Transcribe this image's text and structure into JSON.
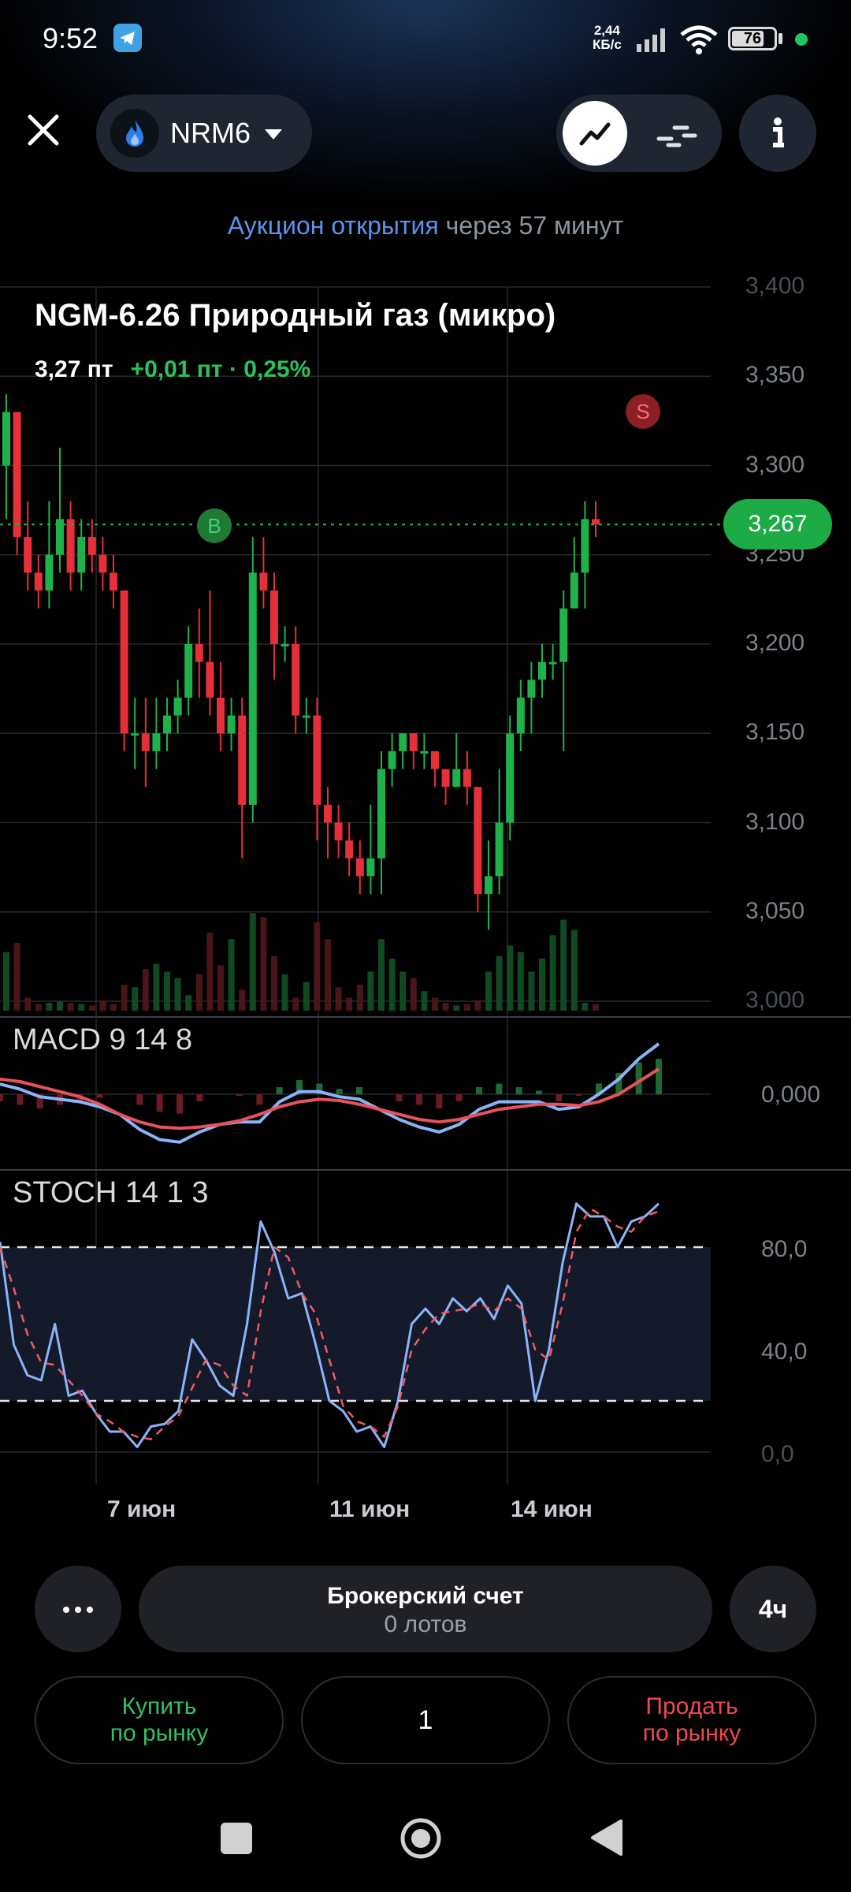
{
  "status_bar": {
    "time": "9:52",
    "net_speed_value": "2,44",
    "net_speed_unit": "КБ/с",
    "battery": "76",
    "battery_level": 0.76,
    "icons": [
      "telegram-icon",
      "signal-icon",
      "wifi-icon",
      "battery-icon"
    ]
  },
  "header": {
    "ticker": "NRM6",
    "chart_mode_selected": "line",
    "notice_highlight": "Аукцион открытия",
    "notice_rest": " через 57 минут"
  },
  "instrument": {
    "title": "NGM-6.26 Природный газ (микро)",
    "price": "3,27 пт",
    "change": "+0,01 пт · 0,25%",
    "current_price_badge": "3,267"
  },
  "chart_data": [
    {
      "type": "candlestick",
      "price_axis": [
        "3,400",
        "3,350",
        "3,300",
        "3,250",
        "3,200",
        "3,150",
        "3,100",
        "3,050",
        "3,000"
      ],
      "ylim": [
        3.0,
        3.4
      ],
      "date_labels": [
        "7 июн",
        "11 июн",
        "14 июн"
      ],
      "current_price": 3.267,
      "markers": [
        {
          "label": "B",
          "index": 18,
          "price": 3.253,
          "color": "#1e7a35"
        },
        {
          "label": "S",
          "index": 60,
          "price": 3.317,
          "color": "#8a1f24"
        }
      ],
      "candles": [
        [
          3.3,
          3.33,
          3.34,
          3.27
        ],
        [
          3.33,
          3.26,
          3.33,
          3.25
        ],
        [
          3.26,
          3.24,
          3.28,
          3.23
        ],
        [
          3.24,
          3.23,
          3.25,
          3.22
        ],
        [
          3.23,
          3.25,
          3.28,
          3.22
        ],
        [
          3.25,
          3.27,
          3.31,
          3.24
        ],
        [
          3.27,
          3.24,
          3.28,
          3.23
        ],
        [
          3.24,
          3.26,
          3.27,
          3.23
        ],
        [
          3.26,
          3.25,
          3.27,
          3.24
        ],
        [
          3.25,
          3.24,
          3.26,
          3.23
        ],
        [
          3.24,
          3.23,
          3.25,
          3.22
        ],
        [
          3.23,
          3.15,
          3.23,
          3.14
        ],
        [
          3.15,
          3.15,
          3.17,
          3.13
        ],
        [
          3.15,
          3.14,
          3.17,
          3.12
        ],
        [
          3.14,
          3.15,
          3.17,
          3.13
        ],
        [
          3.15,
          3.16,
          3.17,
          3.14
        ],
        [
          3.16,
          3.17,
          3.18,
          3.15
        ],
        [
          3.17,
          3.2,
          3.21,
          3.16
        ],
        [
          3.2,
          3.19,
          3.22,
          3.17
        ],
        [
          3.19,
          3.17,
          3.23,
          3.16
        ],
        [
          3.17,
          3.15,
          3.19,
          3.14
        ],
        [
          3.15,
          3.16,
          3.17,
          3.14
        ],
        [
          3.16,
          3.11,
          3.17,
          3.08
        ],
        [
          3.11,
          3.24,
          3.26,
          3.1
        ],
        [
          3.24,
          3.23,
          3.26,
          3.22
        ],
        [
          3.23,
          3.2,
          3.24,
          3.18
        ],
        [
          3.2,
          3.2,
          3.21,
          3.19
        ],
        [
          3.2,
          3.16,
          3.21,
          3.15
        ],
        [
          3.16,
          3.16,
          3.17,
          3.15
        ],
        [
          3.16,
          3.11,
          3.17,
          3.09
        ],
        [
          3.11,
          3.1,
          3.12,
          3.08
        ],
        [
          3.1,
          3.09,
          3.11,
          3.08
        ],
        [
          3.09,
          3.08,
          3.1,
          3.07
        ],
        [
          3.08,
          3.07,
          3.09,
          3.06
        ],
        [
          3.07,
          3.08,
          3.11,
          3.06
        ],
        [
          3.08,
          3.13,
          3.14,
          3.06
        ],
        [
          3.13,
          3.14,
          3.15,
          3.12
        ],
        [
          3.14,
          3.15,
          3.15,
          3.13
        ],
        [
          3.15,
          3.14,
          3.15,
          3.13
        ],
        [
          3.14,
          3.14,
          3.15,
          3.13
        ],
        [
          3.14,
          3.13,
          3.14,
          3.12
        ],
        [
          3.13,
          3.12,
          3.13,
          3.11
        ],
        [
          3.12,
          3.13,
          3.15,
          3.12
        ],
        [
          3.13,
          3.12,
          3.14,
          3.11
        ],
        [
          3.12,
          3.06,
          3.12,
          3.05
        ],
        [
          3.06,
          3.07,
          3.09,
          3.04
        ],
        [
          3.07,
          3.1,
          3.13,
          3.06
        ],
        [
          3.1,
          3.15,
          3.16,
          3.09
        ],
        [
          3.15,
          3.17,
          3.18,
          3.14
        ],
        [
          3.17,
          3.18,
          3.19,
          3.15
        ],
        [
          3.18,
          3.19,
          3.2,
          3.17
        ],
        [
          3.19,
          3.19,
          3.2,
          3.18
        ],
        [
          3.19,
          3.22,
          3.23,
          3.14
        ],
        [
          3.22,
          3.24,
          3.26,
          3.22
        ],
        [
          3.24,
          3.27,
          3.28,
          3.22
        ],
        [
          3.27,
          3.267,
          3.28,
          3.26
        ]
      ],
      "volumes": [
        0.45,
        0.52,
        0.1,
        0.05,
        0.06,
        0.07,
        0.06,
        0.05,
        0.04,
        0.08,
        0.05,
        0.2,
        0.18,
        0.32,
        0.36,
        0.3,
        0.25,
        0.12,
        0.28,
        0.6,
        0.35,
        0.55,
        0.16,
        0.75,
        0.72,
        0.42,
        0.28,
        0.1,
        0.22,
        0.68,
        0.55,
        0.18,
        0.1,
        0.2,
        0.3,
        0.55,
        0.4,
        0.3,
        0.25,
        0.15,
        0.1,
        0.06,
        0.04,
        0.05,
        0.08,
        0.3,
        0.42,
        0.5,
        0.45,
        0.3,
        0.4,
        0.58,
        0.7,
        0.62,
        0.06,
        0.05
      ]
    },
    {
      "type": "line",
      "title": "MACD 9 14 8",
      "axis_labels": [
        "0,000"
      ],
      "series": [
        {
          "color": "#8ab4f8",
          "values": [
            0.4,
            0.2,
            -0.1,
            -0.2,
            -0.3,
            -0.5,
            -0.8,
            -1.4,
            -1.8,
            -1.9,
            -1.5,
            -1.2,
            -1.1,
            -1.1,
            -0.3,
            0.1,
            0.1,
            -0.1,
            -0.2,
            -0.6,
            -1.0,
            -1.3,
            -1.5,
            -1.2,
            -0.6,
            -0.3,
            -0.3,
            -0.3,
            -0.6,
            -0.5,
            0.0,
            0.6,
            1.4,
            2.0
          ]
        },
        {
          "color": "#e8525a",
          "values": [
            0.6,
            0.5,
            0.3,
            0.1,
            -0.1,
            -0.4,
            -0.8,
            -1.1,
            -1.3,
            -1.35,
            -1.3,
            -1.2,
            -1.05,
            -0.8,
            -0.5,
            -0.3,
            -0.2,
            -0.25,
            -0.4,
            -0.6,
            -0.8,
            -1.0,
            -1.1,
            -1.0,
            -0.8,
            -0.6,
            -0.5,
            -0.4,
            -0.4,
            -0.45,
            -0.3,
            0.0,
            0.5,
            1.0
          ]
        }
      ],
      "histogram": [
        -0.2,
        -0.3,
        -0.4,
        -0.3,
        -0.2,
        -0.1,
        0.0,
        -0.3,
        -0.5,
        -0.55,
        -0.2,
        0.0,
        -0.05,
        -0.3,
        0.2,
        0.4,
        0.3,
        0.15,
        0.2,
        0.0,
        -0.2,
        -0.3,
        -0.4,
        -0.2,
        0.2,
        0.3,
        0.2,
        0.1,
        -0.2,
        -0.05,
        0.3,
        0.6,
        0.9,
        1.0
      ]
    },
    {
      "type": "line",
      "title": "STOCH 14 1 3",
      "axis_labels": [
        "80,0",
        "40,0",
        "0,0"
      ],
      "ylim": [
        0,
        100
      ],
      "bands": [
        20,
        80
      ],
      "series": [
        {
          "color": "#8ab4f8",
          "values": [
            82,
            42,
            30,
            28,
            50,
            22,
            24,
            15,
            8,
            8,
            2,
            10,
            11,
            16,
            44,
            36,
            26,
            22,
            50,
            90,
            78,
            60,
            62,
            42,
            20,
            16,
            8,
            10,
            2,
            20,
            50,
            56,
            50,
            60,
            55,
            60,
            52,
            65,
            58,
            20,
            40,
            74,
            97,
            92,
            92,
            80,
            90,
            92,
            97
          ]
        },
        {
          "color": "#ef5a62",
          "values": [
            80,
            64,
            46,
            35,
            34,
            28,
            22,
            15,
            12,
            8,
            6,
            5,
            10,
            14,
            25,
            36,
            34,
            26,
            22,
            55,
            80,
            76,
            62,
            54,
            36,
            18,
            12,
            10,
            6,
            18,
            40,
            48,
            54,
            55,
            56,
            58,
            55,
            60,
            56,
            40,
            36,
            58,
            86,
            95,
            92,
            88,
            86,
            92,
            94
          ]
        }
      ]
    }
  ],
  "controls": {
    "account_title": "Брокерский счет",
    "account_sub": "0 лотов",
    "timeframe": "4ч",
    "buy_line1": "Купить",
    "buy_line2": "по рынку",
    "quantity": "1",
    "sell_line1": "Продать",
    "sell_line2": "по рынку"
  },
  "colors": {
    "up": "#1fb24a",
    "down": "#e5303a",
    "accent_blue": "#5a93ee",
    "button_bg": "#1f2126"
  }
}
